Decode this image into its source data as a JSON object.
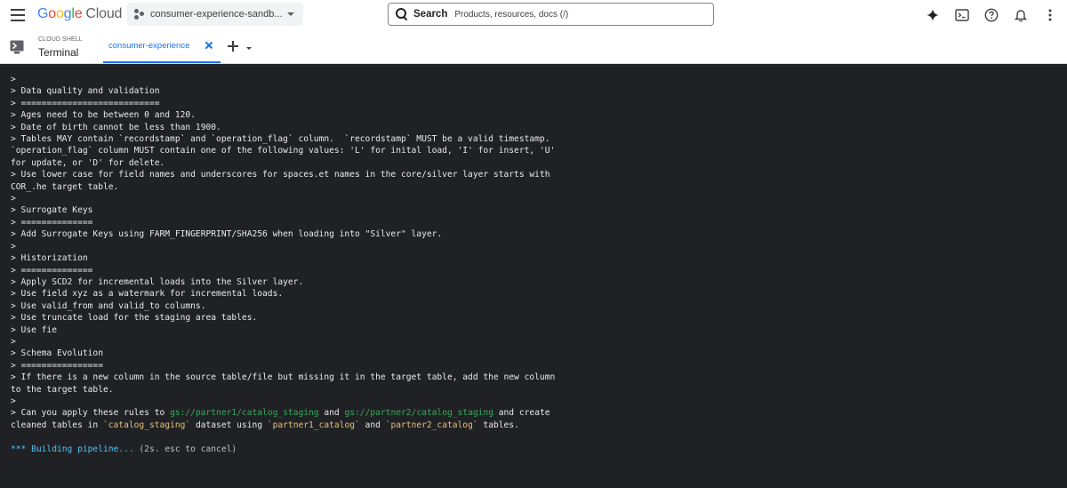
{
  "header": {
    "logo": {
      "google": [
        "G",
        "o",
        "o",
        "g",
        "l",
        "e"
      ],
      "cloud": "Cloud"
    },
    "project_picker": {
      "label": "consumer-experience-sandb..."
    },
    "search": {
      "label": "Search",
      "placeholder": "Products, resources, docs (/)"
    },
    "icons": [
      "gemini-spark-icon",
      "cloud-shell-icon",
      "help-icon",
      "notifications-icon",
      "more-vert-icon"
    ]
  },
  "subbar": {
    "section_label": "CLOUD SHELL",
    "title": "Terminal",
    "tabs": [
      {
        "label": "consumer-experience"
      }
    ]
  },
  "colors": {
    "accent": "#1a73e8",
    "terminal_bg": "#202124",
    "terminal_text": "#e8eaed",
    "path_green": "#37a85c",
    "code_yellow": "#e5c07b",
    "status_cyan": "#4fc3f7"
  },
  "terminal": {
    "lines": [
      ">",
      "> Data quality and validation",
      "> ===========================",
      "> Ages need to be between 0 and 120.",
      "> Date of birth cannot be less than 1900.",
      "> Tables MAY contain `recordstamp` and `operation_flag` column.  `recordstamp` MUST be a valid timestamp.",
      "`operation_flag` column MUST contain one of the following values: 'L' for inital load, 'I' for insert, 'U'",
      "for update, or 'D' for delete.",
      "> Use lower case for field names and underscores for spaces.et names in the core/silver layer starts with",
      "COR_.he target table.",
      ">",
      "> Surrogate Keys",
      "> ==============",
      "> Add Surrogate Keys using FARM_FINGERPRINT/SHA256 when loading into \"Silver\" layer.",
      ">",
      "> Historization",
      "> ==============",
      "> Apply SCD2 for incremental loads into the Silver layer.",
      "> Use field xyz as a watermark for incremental loads.",
      "> Use valid_from and valid_to columns.",
      "> Use truncate load for the staging area tables.",
      "> Use fie",
      ">",
      "> Schema Evolution",
      "> ================",
      "> If there is a new column in the source table/file but missing it in the target table, add the new column",
      "to the target table.",
      ">"
    ],
    "request": {
      "line1_prefix": "> Can you apply these rules to ",
      "path1": "gs://partner1/catalog_staging",
      "and1": " and ",
      "path2": "gs://partner2/catalog_staging",
      "line1_suffix": " and create",
      "line2_prefix": "cleaned tables in ",
      "dataset": "`catalog_staging`",
      "line2_mid": " dataset using ",
      "src1": "`partner1_catalog`",
      "and2": " and ",
      "src2": "`partner2_catalog`",
      "line2_suffix": " tables."
    },
    "status": {
      "spinner": "*** Building pipeline...",
      "hint": " (2s. esc to cancel)"
    }
  }
}
